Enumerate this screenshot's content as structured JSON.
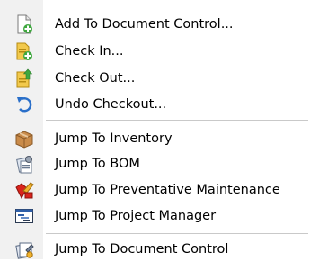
{
  "menu": {
    "items": [
      {
        "label": "Add To Document Control...",
        "icon": "add-document-icon"
      },
      {
        "label": "Check In...",
        "icon": "check-in-icon"
      },
      {
        "label": "Check Out...",
        "icon": "check-out-icon"
      },
      {
        "label": "Undo Checkout...",
        "icon": "undo-icon"
      },
      {
        "label": "Jump To Inventory",
        "icon": "inventory-box-icon"
      },
      {
        "label": "Jump To BOM",
        "icon": "bom-icon"
      },
      {
        "label": "Jump To Preventative Maintenance",
        "icon": "maintenance-icon"
      },
      {
        "label": "Jump To Project Manager",
        "icon": "project-manager-icon"
      },
      {
        "label": "Jump To Document Control",
        "icon": "document-control-icon"
      }
    ]
  }
}
